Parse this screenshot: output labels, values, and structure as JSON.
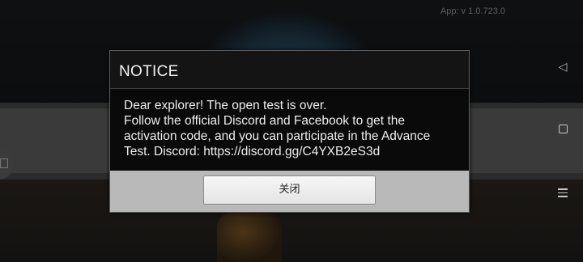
{
  "app_version": "App: v 1.0.723.0",
  "dialog": {
    "title": "NOTICE",
    "message_lines": [
      "Dear explorer!   The open test is over.",
      "Follow the official Discord and Facebook to get the",
      "activation code, and you can participate in the Advance",
      "Test. Discord: https://discord.gg/C4YXB2eS3d"
    ],
    "close_label": "关闭"
  },
  "nav": {
    "back_icon": "back-triangle-icon",
    "home_icon": "home-square-icon",
    "menu_icon": "menu-lines-icon",
    "back_glyph": "◁"
  }
}
